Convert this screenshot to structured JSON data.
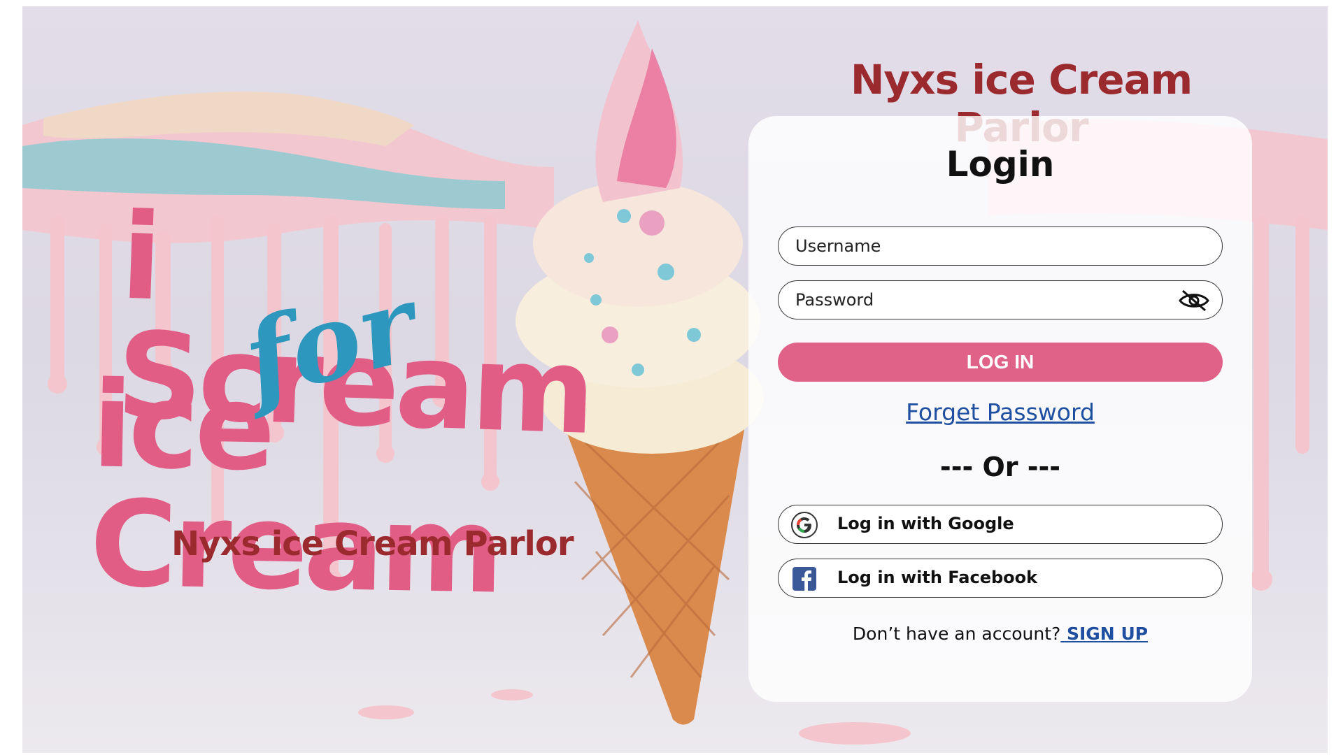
{
  "hero": {
    "line1": "i Scream",
    "line2": "for",
    "line3": "ice Cream",
    "subtitle": "Nyxs ice Cream Parlor"
  },
  "brand": {
    "title": "Nyxs ice Cream Parlor"
  },
  "login_card": {
    "title": "Login",
    "username": {
      "placeholder": "Username",
      "value": ""
    },
    "password": {
      "placeholder": "Password",
      "value": ""
    },
    "login_button": "LOG IN",
    "forgot_password": "Forget Password ",
    "or_divider": "--- Or ---",
    "google_button": "Log in with Google",
    "facebook_button": "Log in with Facebook",
    "signup_prompt": "Don’t have an account?",
    "signup_link": " SIGN UP "
  },
  "icons": {
    "password_toggle": "eye-slash-icon",
    "google": "google-icon",
    "facebook": "facebook-icon"
  },
  "colors": {
    "accent_pink": "#e06289",
    "hero_pink": "#e25d86",
    "hero_blue": "#2e97be",
    "brand_red": "#9b2a2f",
    "link_blue": "#1f4fa0"
  }
}
